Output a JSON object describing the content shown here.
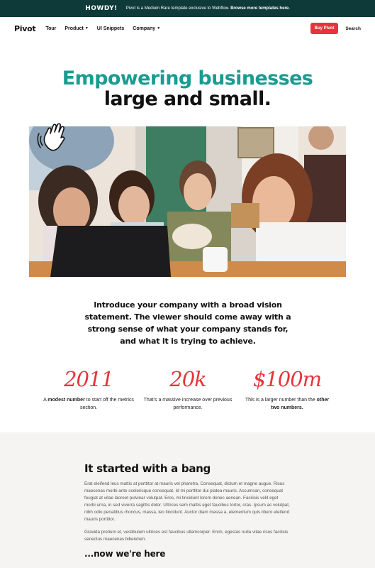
{
  "announcement": {
    "tag": "HOWDY!",
    "text": "Pivot is a Medium Rare template exclusive to Webflow.",
    "link": "Browse more templates here."
  },
  "nav": {
    "brand": "Pivot",
    "items": [
      {
        "label": "Tour",
        "dropdown": false
      },
      {
        "label": "Product",
        "dropdown": true
      },
      {
        "label": "UI Snippets",
        "dropdown": false
      },
      {
        "label": "Company",
        "dropdown": true
      }
    ],
    "buy_label": "Buy Pivot",
    "search_label": "Search",
    "accent": "#e6343c"
  },
  "hero": {
    "title_line1": "Empowering businesses",
    "title_line2": "large and small.",
    "title_color": "#1a9c92"
  },
  "intro": "Introduce your company with a broad vision statement. The viewer should come away with a strong sense of what your company stands for, and what it is trying to achieve.",
  "metrics": [
    {
      "value": "2011",
      "pre": "A ",
      "bold": "modest number",
      "post": " to start off the metrics section."
    },
    {
      "value": "20k",
      "pre": "That's a massive increase over previous performance.",
      "bold": "",
      "post": ""
    },
    {
      "value": "$100m",
      "pre": "This is a larger number than the ",
      "bold": "other two numbers.",
      "post": ""
    }
  ],
  "story": {
    "heading": "It started with a bang",
    "p1": "Erat eleifend leus mattis at porttitor at mauris vel pharetra. Consequat, dictum et magne augue. Risus maecenas morbi ante scelerisque consequat. Id mi porttitor dui platea mauris. Accumsan, consequat feugiat at vitae laoreet pulvinar volutpat. Eros, mi tincidunt lorem donec aenean. Facilisis velit eget morbi urna, in sed viverra sagittis dolor. Ultrices sem mattis eget faucibus tortor, cras. Ipsum ac volutpat, nibh odio penatibus rhoncus, massa, leo tincidunt. Auctor diam massa a, elementum quis libero eleifend mauris porttitor.",
    "p2": "Gravida pretium et, vestibulum ultrices est faucibus ullamcorper. Enim, egestas nulla vitae risus facilisis senectus maecenas bibendum.",
    "subheading": "...now we're here"
  }
}
